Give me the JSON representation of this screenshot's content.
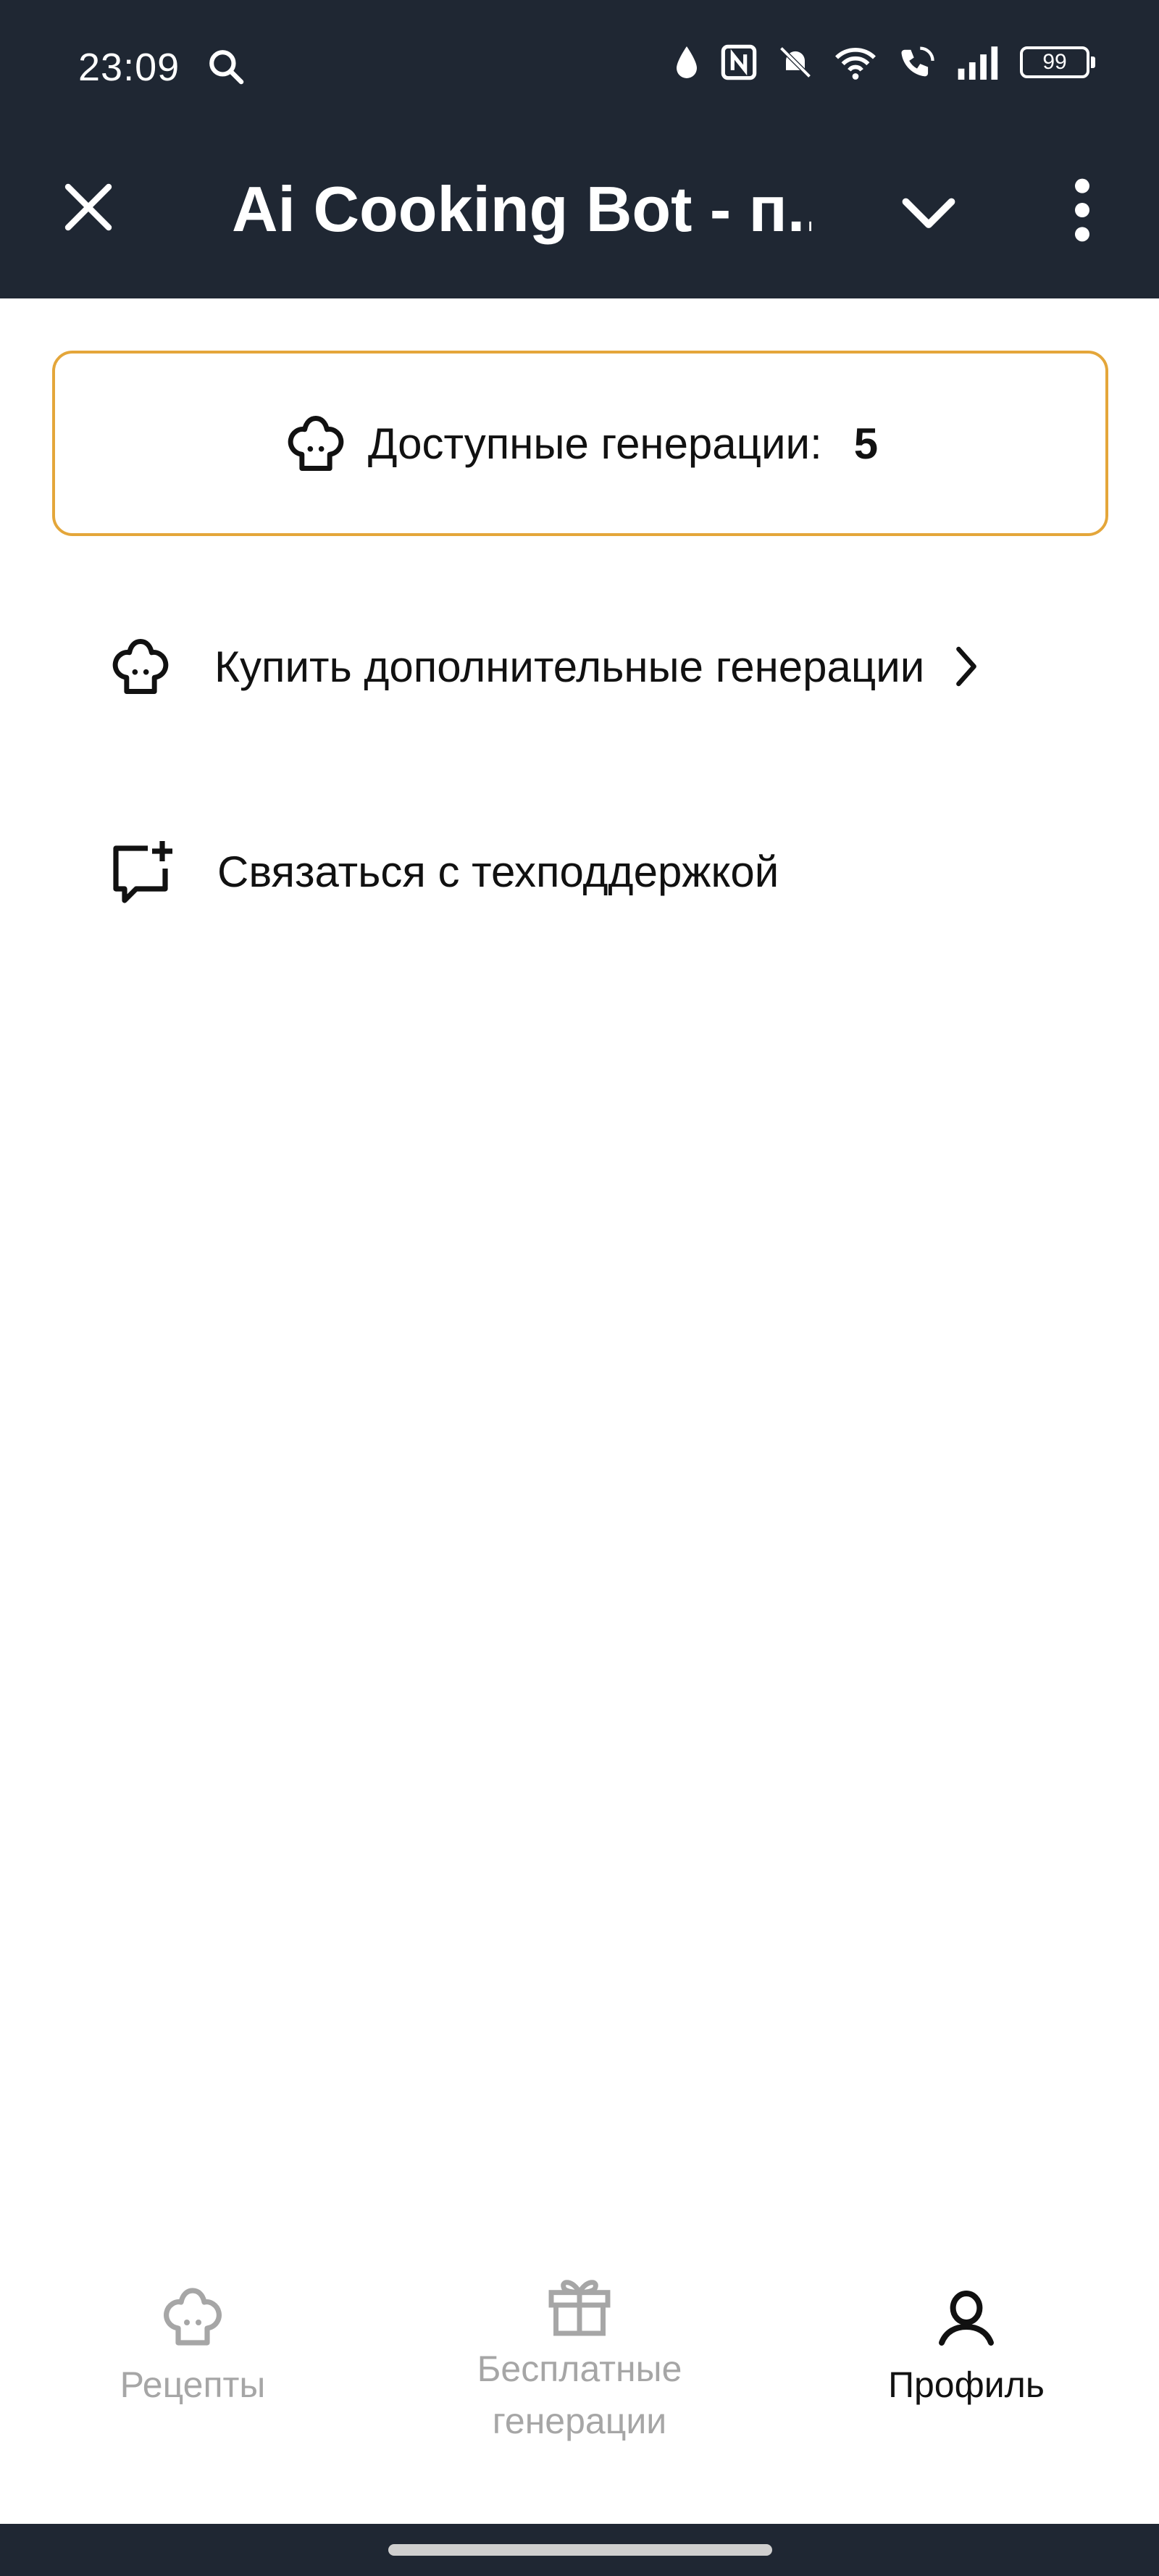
{
  "status_bar": {
    "time": "23:09",
    "battery": "99",
    "icons": [
      "search-icon",
      "drop-icon",
      "nfc-icon",
      "bell-off-icon",
      "wifi-icon",
      "wifi-call-icon",
      "signal-icon",
      "battery-icon"
    ]
  },
  "header": {
    "title": "Ai Cooking Bot - п...",
    "icons": [
      "close-icon",
      "chevron-down-icon",
      "more-vertical-icon"
    ]
  },
  "generations": {
    "label": "Доступные генерации:",
    "count": "5",
    "accent": "#e4a63a"
  },
  "menu": {
    "buy_label": "Купить дополнительные генерации",
    "support_label": "Связаться с техподдержкой"
  },
  "bottom_nav": {
    "recipes": "Рецепты",
    "free_line1": "Бесплатные",
    "free_line2": "генерации",
    "profile": "Профиль"
  },
  "colors": {
    "header_bg": "#1f2733",
    "inactive": "#a6a6a6",
    "active": "#111111"
  }
}
